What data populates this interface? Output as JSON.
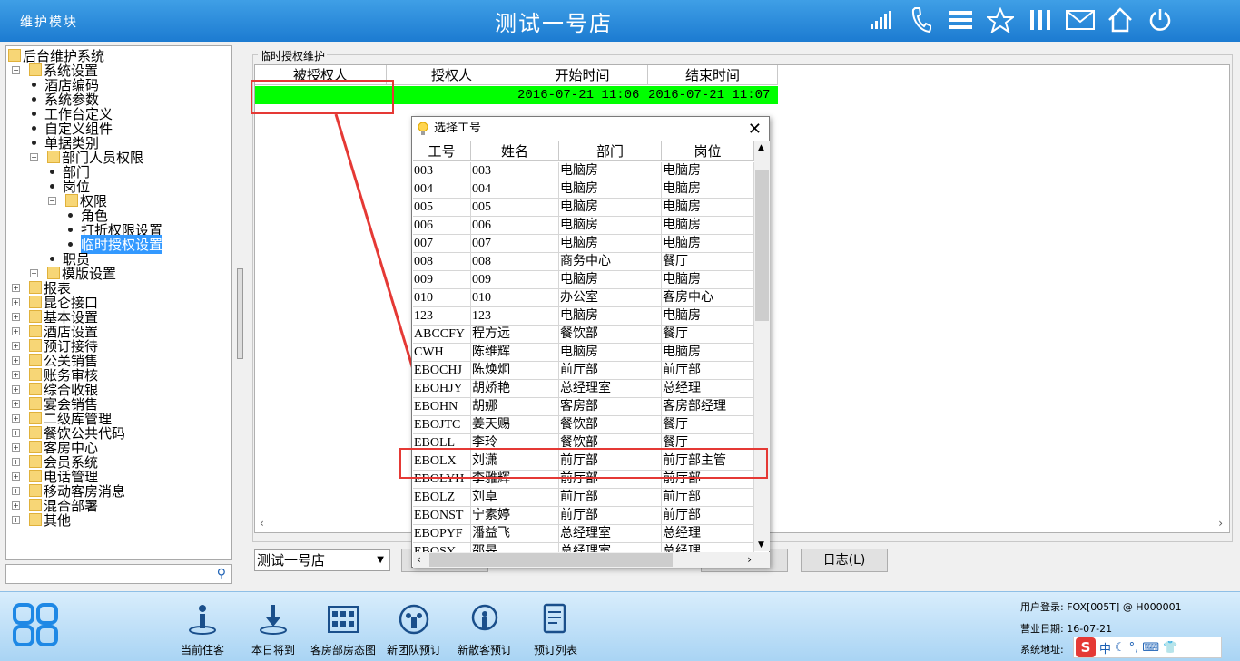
{
  "header": {
    "module_title": "维护模块",
    "store_title": "测试一号店",
    "icons": [
      "signal-icon",
      "phone-icon",
      "menu-icon",
      "star-icon",
      "bars-icon",
      "mail-icon",
      "home-icon",
      "power-icon"
    ]
  },
  "tree": [
    {
      "label": "后台维护系统",
      "type": "folder",
      "level": 0
    },
    {
      "label": "系统设置",
      "type": "folder",
      "level": 1,
      "expanded": true
    },
    {
      "label": "酒店编码",
      "type": "leaf",
      "level": 2
    },
    {
      "label": "系统参数",
      "type": "leaf",
      "level": 2
    },
    {
      "label": "工作台定义",
      "type": "leaf",
      "level": 2
    },
    {
      "label": "自定义组件",
      "type": "leaf",
      "level": 2
    },
    {
      "label": "单据类别",
      "type": "leaf",
      "level": 2
    },
    {
      "label": "部门人员权限",
      "type": "folder",
      "level": 2,
      "expanded": true
    },
    {
      "label": "部门",
      "type": "leaf",
      "level": 3
    },
    {
      "label": "岗位",
      "type": "leaf",
      "level": 3
    },
    {
      "label": "权限",
      "type": "folder",
      "level": 3,
      "expanded": true
    },
    {
      "label": "角色",
      "type": "leaf",
      "level": 4
    },
    {
      "label": "打折权限设置",
      "type": "leaf",
      "level": 4
    },
    {
      "label": "临时授权设置",
      "type": "leaf",
      "level": 4,
      "selected": true
    },
    {
      "label": "职员",
      "type": "leaf",
      "level": 3
    },
    {
      "label": "模版设置",
      "type": "folder",
      "level": 2
    },
    {
      "label": "报表",
      "type": "folder",
      "level": 1
    },
    {
      "label": "昆仑接口",
      "type": "folder",
      "level": 1
    },
    {
      "label": "基本设置",
      "type": "folder",
      "level": 1
    },
    {
      "label": "酒店设置",
      "type": "folder",
      "level": 1
    },
    {
      "label": "预订接待",
      "type": "folder",
      "level": 1
    },
    {
      "label": "公关销售",
      "type": "folder",
      "level": 1
    },
    {
      "label": "账务审核",
      "type": "folder",
      "level": 1
    },
    {
      "label": "综合收银",
      "type": "folder",
      "level": 1
    },
    {
      "label": "宴会销售",
      "type": "folder",
      "level": 1
    },
    {
      "label": "二级库管理",
      "type": "folder",
      "level": 1
    },
    {
      "label": "餐饮公共代码",
      "type": "folder",
      "level": 1
    },
    {
      "label": "客房中心",
      "type": "folder",
      "level": 1
    },
    {
      "label": "会员系统",
      "type": "folder",
      "level": 1
    },
    {
      "label": "电话管理",
      "type": "folder",
      "level": 1
    },
    {
      "label": "移动客房消息",
      "type": "folder",
      "level": 1
    },
    {
      "label": "混合部署",
      "type": "folder",
      "level": 1
    },
    {
      "label": "其他",
      "type": "folder",
      "level": 1
    }
  ],
  "main": {
    "group_label": "临时授权维护",
    "columns": [
      "被授权人",
      "授权人",
      "开始时间",
      "结束时间"
    ],
    "rows": [
      [
        "",
        "",
        "2016-07-21 11:06",
        "2016-07-21 11:07"
      ]
    ],
    "row_color": "#00ff00",
    "store_select": "测试一号店",
    "log_button": "日志(L)"
  },
  "dialog": {
    "title": "选择工号",
    "columns": [
      "工号",
      "姓名",
      "部门",
      "岗位"
    ],
    "rows": [
      [
        "003",
        "003",
        "电脑房",
        "电脑房"
      ],
      [
        "004",
        "004",
        "电脑房",
        "电脑房"
      ],
      [
        "005",
        "005",
        "电脑房",
        "电脑房"
      ],
      [
        "006",
        "006",
        "电脑房",
        "电脑房"
      ],
      [
        "007",
        "007",
        "电脑房",
        "电脑房"
      ],
      [
        "008",
        "008",
        "商务中心",
        "餐厅"
      ],
      [
        "009",
        "009",
        "电脑房",
        "电脑房"
      ],
      [
        "010",
        "010",
        "办公室",
        "客房中心"
      ],
      [
        "123",
        "123",
        "电脑房",
        "电脑房"
      ],
      [
        "ABCCFY",
        "程方远",
        "餐饮部",
        "餐厅"
      ],
      [
        "CWH",
        "陈维辉",
        "电脑房",
        "电脑房"
      ],
      [
        "EBOCHJ",
        "陈焕炯",
        "前厅部",
        "前厅部"
      ],
      [
        "EBOHJY",
        "胡娇艳",
        "总经理室",
        "总经理"
      ],
      [
        "EBOHN",
        "胡娜",
        "客房部",
        "客房部经理"
      ],
      [
        "EBOJTC",
        "姜天赐",
        "餐饮部",
        "餐厅"
      ],
      [
        "EBOLL",
        "李玲",
        "餐饮部",
        "餐厅"
      ],
      [
        "EBOLX",
        "刘潇",
        "前厅部",
        "前厅部主管"
      ],
      [
        "EBOLYH",
        "李雅辉",
        "前厅部",
        "前厅部"
      ],
      [
        "EBOLZ",
        "刘卓",
        "前厅部",
        "前厅部"
      ],
      [
        "EBONST",
        "宁素婷",
        "前厅部",
        "前厅部"
      ],
      [
        "EBOPYF",
        "潘益飞",
        "总经理室",
        "总经理"
      ],
      [
        "EBOSY",
        "邵旻",
        "总经理室",
        "总经理"
      ]
    ]
  },
  "bottom": {
    "buttons": [
      {
        "label": "当前住客",
        "icon": "guest-icon"
      },
      {
        "label": "本日将到",
        "icon": "arrival-icon"
      },
      {
        "label": "客房部房态图",
        "icon": "room-status-icon"
      },
      {
        "label": "新团队预订",
        "icon": "group-booking-icon"
      },
      {
        "label": "新散客预订",
        "icon": "walkin-booking-icon"
      },
      {
        "label": "预订列表",
        "icon": "booking-list-icon"
      }
    ],
    "user_login": "用户登录: FOX[005T] @ H000001",
    "business_date": "营业日期: 16-07-21",
    "system_address": "系统地址:"
  }
}
